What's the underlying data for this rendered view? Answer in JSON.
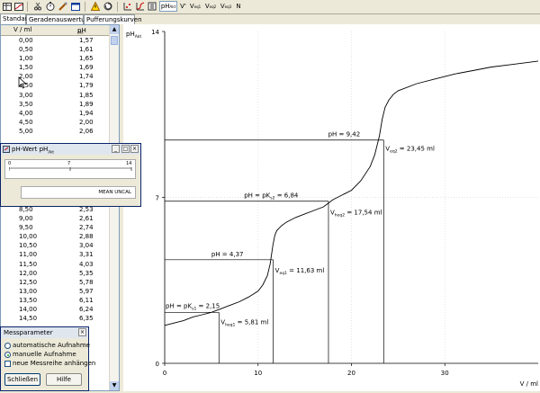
{
  "toolbar": {
    "buttons": [
      "pH",
      "V'",
      "V",
      "V",
      "V",
      "N"
    ],
    "ph_label": "pH",
    "ph_sub": "Akt",
    "v1_sub": "eq1",
    "v2_sub": "eq2",
    "v3_sub": "eq3"
  },
  "tabs": [
    "Standard",
    "Geradenauswertung",
    "Pufferungskurven"
  ],
  "table": {
    "col_v": "V / ml",
    "col_ph": "pH",
    "col_ph_sub": "Akt",
    "top_rows": [
      [
        "0,00",
        "1,57"
      ],
      [
        "0,50",
        "1,61"
      ],
      [
        "1,00",
        "1,65"
      ],
      [
        "1,50",
        "1,69"
      ],
      [
        "2,00",
        "1,74"
      ],
      [
        "2,50",
        "1,79"
      ],
      [
        "3,00",
        "1,85"
      ],
      [
        "3,50",
        "1,89"
      ],
      [
        "4,00",
        "1,94"
      ],
      [
        "4,50",
        "2,00"
      ],
      [
        "5,00",
        "2,06"
      ]
    ],
    "bottom_rows": [
      [
        "8,50",
        "2,53"
      ],
      [
        "9,00",
        "2,61"
      ],
      [
        "9,50",
        "2,74"
      ],
      [
        "10,00",
        "2,88"
      ],
      [
        "10,50",
        "3,04"
      ],
      [
        "11,00",
        "3,31"
      ],
      [
        "11,50",
        "4,03"
      ],
      [
        "12,00",
        "5,35"
      ],
      [
        "12,50",
        "5,78"
      ],
      [
        "13,00",
        "5,97"
      ],
      [
        "13,50",
        "6,11"
      ],
      [
        "14,00",
        "6,24"
      ],
      [
        "14,50",
        "6,35"
      ]
    ]
  },
  "ph_dialog": {
    "title": "pH-Wert pH",
    "title_sub": "Akt",
    "scale": [
      "0",
      "7",
      "14"
    ],
    "status": "MEAN UNCAL"
  },
  "mess_dialog": {
    "title": "Messparameter",
    "opt_auto": "automatische Aufnahme",
    "opt_manual": "manuelle Aufnahme",
    "chk_append": "neue Messreihe anhängen",
    "btn_close": "Schließen",
    "btn_help": "Hilfe"
  },
  "chart_data": {
    "type": "line",
    "ylabel": "pH",
    "ylabel_sub": "Akt",
    "xlabel": "V / ml",
    "xlim": [
      0,
      40
    ],
    "ylim": [
      0,
      14
    ],
    "x_ticks": [
      "0",
      "10",
      "20",
      "30"
    ],
    "y_ticks": [
      "0",
      "7",
      "14"
    ],
    "series": [
      {
        "x": [
          0,
          1,
          2,
          3,
          4,
          5,
          6,
          7,
          8,
          9,
          10,
          10.5,
          11,
          11.3,
          11.6,
          11.8,
          12,
          12.5,
          13,
          14,
          15,
          16,
          17,
          17.5,
          18,
          19,
          20,
          21,
          22,
          22.5,
          23,
          23.3,
          23.6,
          24,
          24.5,
          25,
          27,
          29,
          31,
          33,
          35,
          37,
          39,
          40
        ],
        "y": [
          1.6,
          1.7,
          1.8,
          1.95,
          2.05,
          2.15,
          2.3,
          2.45,
          2.6,
          2.8,
          3.05,
          3.3,
          3.7,
          4.2,
          5.0,
          5.4,
          5.6,
          5.8,
          5.95,
          6.15,
          6.3,
          6.45,
          6.6,
          6.75,
          6.9,
          7.1,
          7.3,
          7.7,
          8.3,
          8.8,
          9.6,
          10.3,
          10.8,
          11.1,
          11.35,
          11.5,
          11.8,
          12.0,
          12.2,
          12.35,
          12.5,
          12.6,
          12.7,
          12.75
        ]
      }
    ],
    "annotations": [
      {
        "text": "pH = pK",
        "sub": "s1",
        "tail": " = 2,15",
        "x": 6.2,
        "y": 2.15
      },
      {
        "text": "pH = 4,37",
        "x": 11.63,
        "y": 4.37
      },
      {
        "text": "pH = pK",
        "sub": "s2",
        "tail": " = 6,84",
        "x": 17.54,
        "y": 6.84
      },
      {
        "text": "pH = 9,42",
        "x": 23.45,
        "y": 9.42
      },
      {
        "text": "V",
        "sub": "heq1",
        "tail": " = 5,81 ml"
      },
      {
        "text": "V",
        "sub": "eq1",
        "tail": " = 11,63 ml"
      },
      {
        "text": "V",
        "sub": "heq2",
        "tail": " = 17,54 ml"
      },
      {
        "text": "V",
        "sub": "eq2",
        "tail": " = 23,45 ml"
      }
    ]
  }
}
